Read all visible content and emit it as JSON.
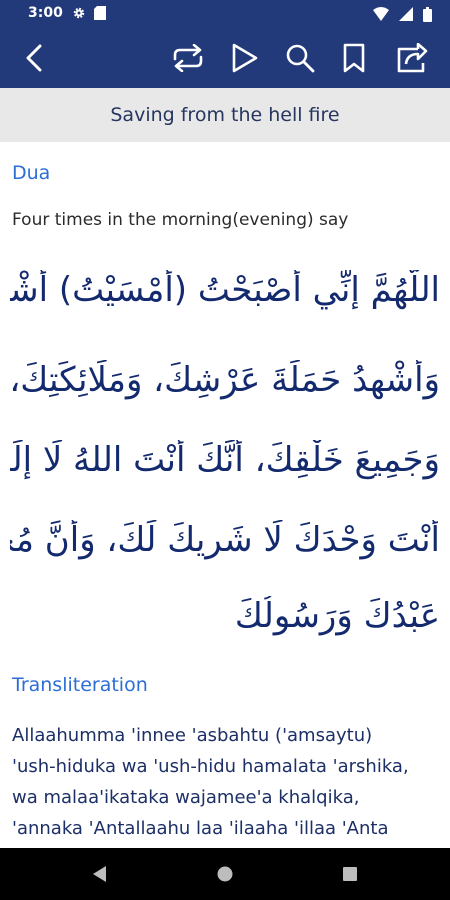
{
  "status": {
    "time": "3:00",
    "icons": [
      "settings-gear-icon",
      "sd-card-icon",
      "wifi-icon",
      "signal-icon",
      "battery-icon"
    ]
  },
  "toolbar": {
    "icons": [
      "back-arrow-icon",
      "repeat-icon",
      "play-icon",
      "search-icon",
      "bookmark-icon",
      "share-icon"
    ]
  },
  "page": {
    "subtitle": "Saving from the hell fire"
  },
  "dua": {
    "heading": "Dua",
    "intro": "Four times in the morning(evening) say",
    "arabic_lines": [
      "اللَّهُمَّ إِنِّي أَصْبَحْتُ (أَمْسَيْتُ) أُشْهِدُكَ",
      "وَأُشْهِدُ حَمَلَةَ عَرْشِكَ، وَمَلَائِكَتِكَ،",
      "وَجَمِيعَ خَلْقِكَ، أَنَّكَ أَنْتَ اللهُ لَا إِلَهَ إِلَّا",
      "أَنْتَ وَحْدَكَ لَا شَرِيكَ لَكَ، وَأَنَّ مُحَمَّدًا",
      "عَبْدُكَ وَرَسُولُكَ"
    ]
  },
  "transliteration": {
    "heading": "Transliteration",
    "lines": [
      "Allaahumma 'innee 'asbahtu ('amsaytu)",
      "'ush-hiduka wa 'ush-hidu hamalata 'arshika,",
      "wa malaa'ikataka wajamee'a khalqika,",
      "'annaka 'Antallaahu laa 'ilaaha 'illaa 'Anta"
    ]
  },
  "navbar": {
    "icons": [
      "nav-back-icon",
      "nav-home-icon",
      "nav-recents-icon"
    ]
  },
  "colors": {
    "primary": "#22397a",
    "accent_link": "#2c6ed6",
    "arabic_text": "#142a6e",
    "subtitle_bg": "#e8e8e8"
  }
}
